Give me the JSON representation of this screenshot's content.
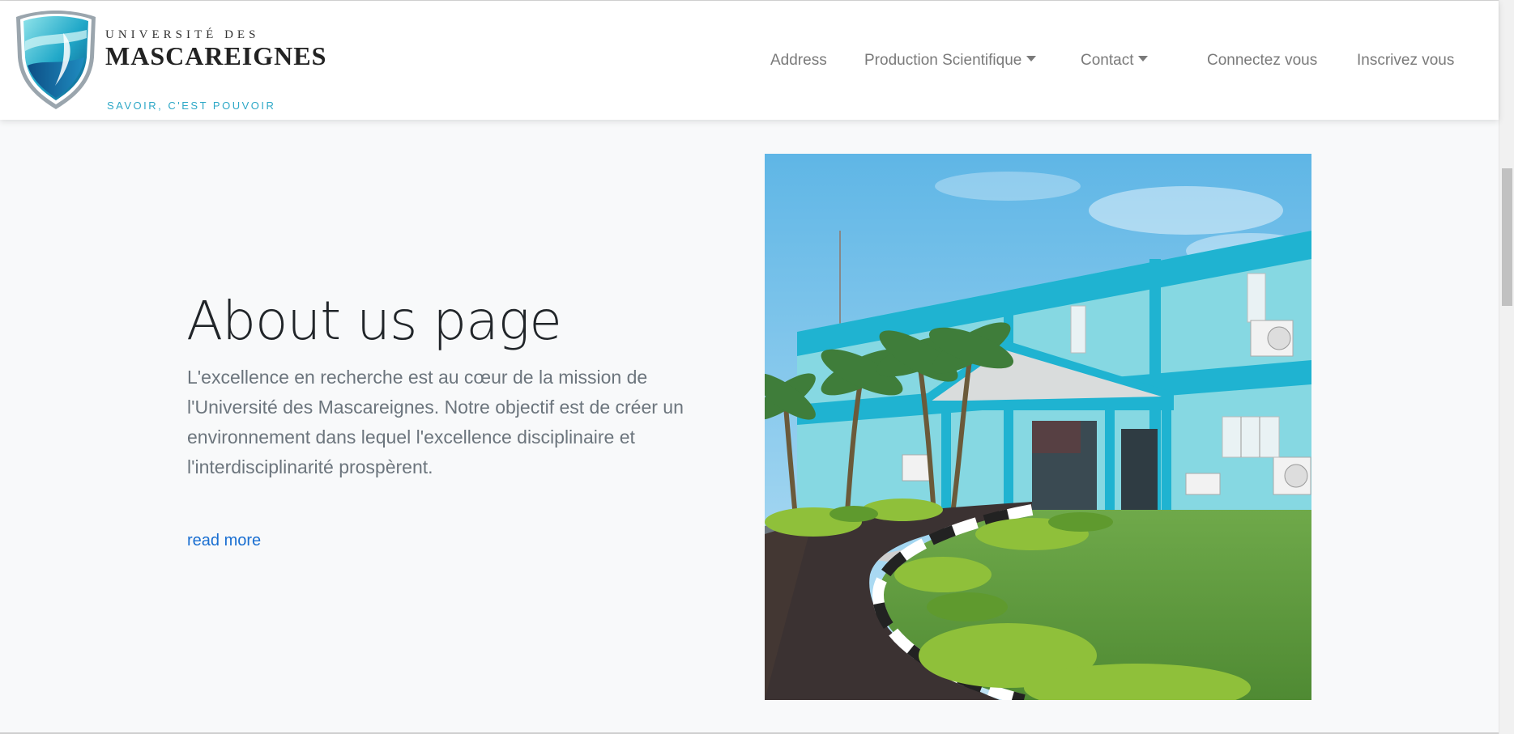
{
  "logo": {
    "line1": "UNIVERSITÉ DES",
    "line2": "MASCAREIGNES",
    "tagline": "SAVOIR, C'EST POUVOIR"
  },
  "nav": {
    "address": "Address",
    "production": "Production Scientifique",
    "contact": "Contact",
    "login": "Connectez vous",
    "register": "Inscrivez vous"
  },
  "hero": {
    "title": "About us page",
    "paragraph": "L'excellence en recherche est au cœur de la mission de l'Université des Mascareignes. Notre objectif est de créer un environnement dans lequel l'excellence disciplinaire et l'interdisciplinarité prospèrent.",
    "read_more": "read more"
  },
  "colors": {
    "accent_link": "#1a6fd1",
    "building": "#7fd7e0",
    "building_trim": "#1fb3d1",
    "tagline": "#2ea8c7"
  },
  "icons": {
    "dropdown": "caret-down-icon",
    "logo": "university-shield-logo"
  }
}
